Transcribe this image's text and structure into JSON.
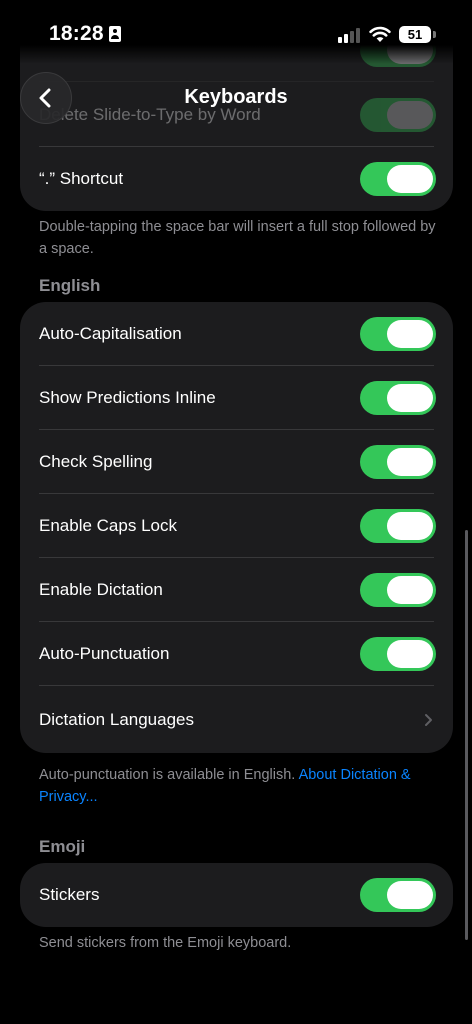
{
  "status_bar": {
    "time": "18:28",
    "battery": "51"
  },
  "nav": {
    "title": "Keyboards"
  },
  "top_group": {
    "hidden_row": "Delete Slide-to-Type by Word",
    "shortcut_label": "“.” Shortcut",
    "shortcut_footer": "Double-tapping the space bar will insert a full stop followed by a space."
  },
  "english": {
    "header": "English",
    "rows": [
      {
        "label": "Auto-Capitalisation",
        "on": true
      },
      {
        "label": "Show Predictions Inline",
        "on": true
      },
      {
        "label": "Check Spelling",
        "on": true
      },
      {
        "label": "Enable Caps Lock",
        "on": true
      },
      {
        "label": "Enable Dictation",
        "on": true
      },
      {
        "label": "Auto-Punctuation",
        "on": true
      }
    ],
    "dictation_languages": "Dictation Languages",
    "footer_text": "Auto-punctuation is available in English. ",
    "footer_link": "About Dictation & Privacy..."
  },
  "emoji": {
    "header": "Emoji",
    "stickers_label": "Stickers",
    "stickers_on": true,
    "footer": "Send stickers from the Emoji keyboard."
  },
  "colors": {
    "accent_green": "#34c759",
    "link_blue": "#0a84ff",
    "cell": "#1c1c1e"
  }
}
